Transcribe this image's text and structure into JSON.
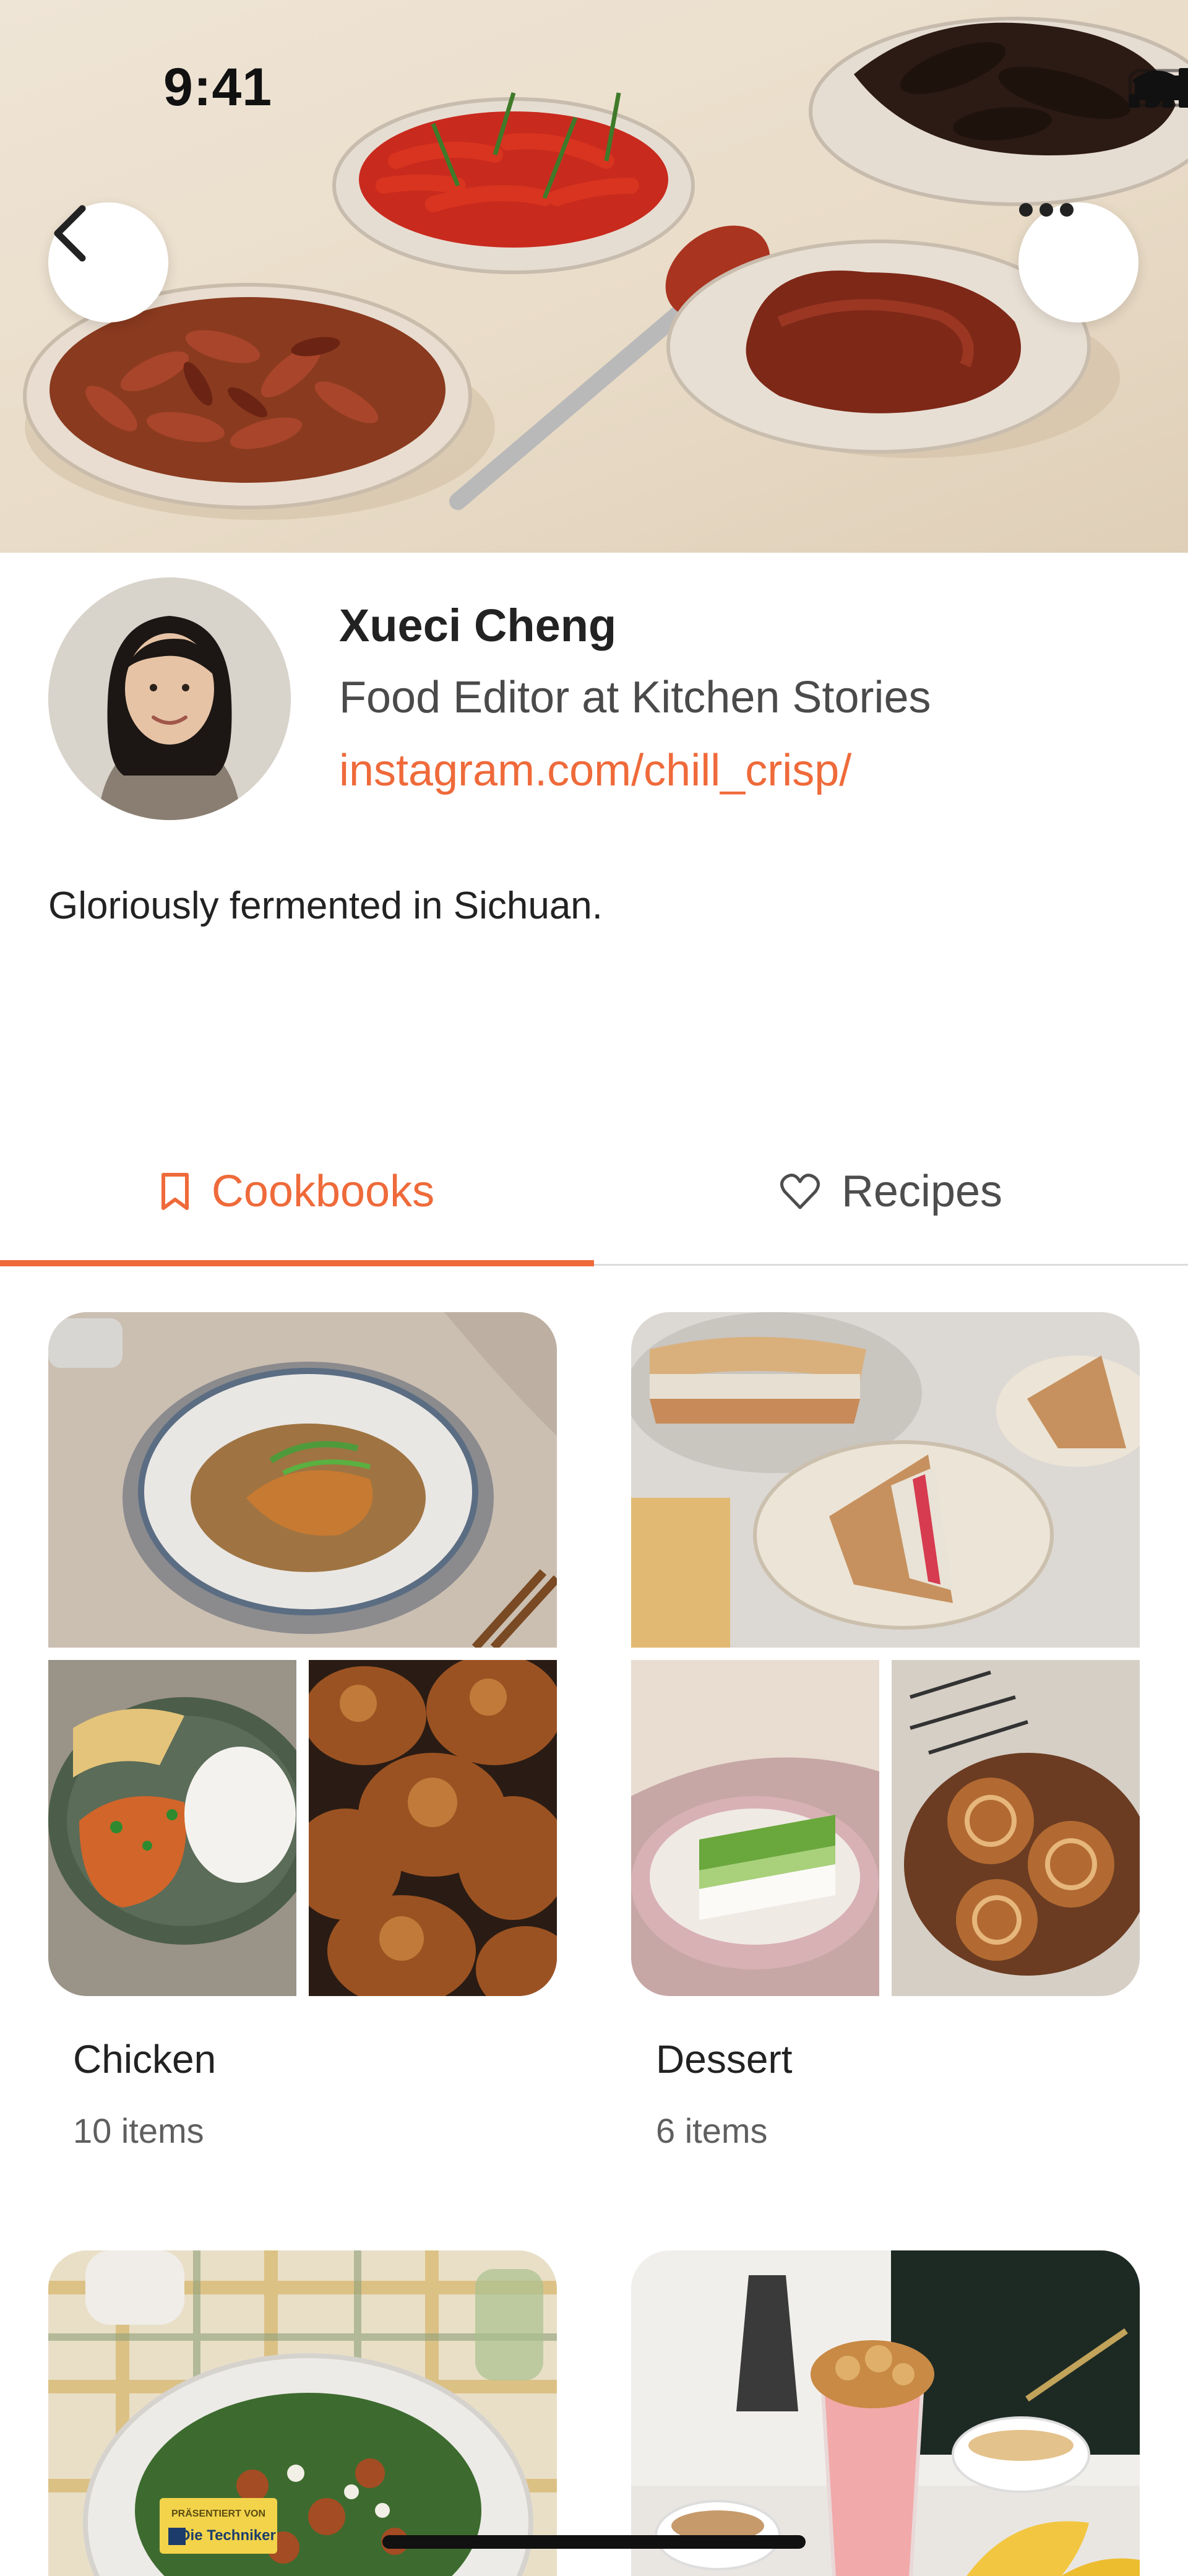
{
  "status_bar": {
    "time": "9:41",
    "icons": [
      "signal-icon",
      "wifi-icon",
      "battery-icon"
    ]
  },
  "header": {
    "back_icon": "chevron-left-icon",
    "more_icon": "ellipsis-icon"
  },
  "profile": {
    "name": "Xueci Cheng",
    "role": "Food Editor at Kitchen Stories",
    "link": "instagram.com/chill_crisp/",
    "bio": "Gloriously fermented in Sichuan."
  },
  "tabs": [
    {
      "label": "Cookbooks",
      "icon": "bookmark-icon",
      "active": true
    },
    {
      "label": "Recipes",
      "icon": "heart-icon",
      "active": false
    }
  ],
  "cookbooks": [
    {
      "title": "Chicken",
      "count": "10 items"
    },
    {
      "title": "Dessert",
      "count": "6 items"
    },
    {
      "title": "",
      "count": ""
    },
    {
      "title": "",
      "count": ""
    }
  ],
  "sponsor_badge": {
    "line1": "PRÄSENTIERT VON",
    "line2": "Die Techniker"
  },
  "colors": {
    "accent": "#ef6a3a",
    "text": "#222222",
    "muted": "#5f5f5f",
    "divider": "#dcdcdc"
  }
}
